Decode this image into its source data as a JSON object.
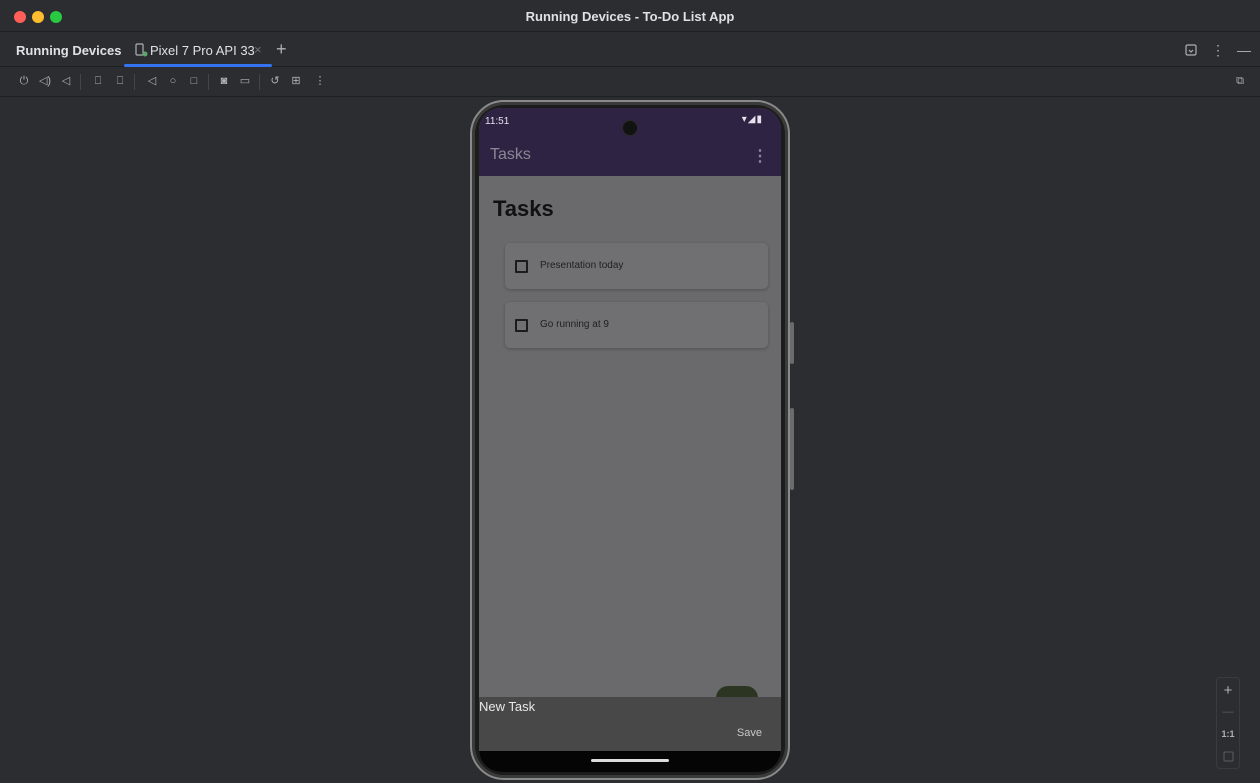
{
  "window": {
    "title": "Running Devices - To-Do List App"
  },
  "tool_window": {
    "title": "Running Devices",
    "tab": {
      "label": "Pixel 7 Pro API 33",
      "close": "×"
    },
    "add_tab": "+"
  },
  "header_actions": {
    "minimize": "—",
    "more": "⋮"
  },
  "toolbar": {
    "icons": [
      "power-icon",
      "volume-up-icon",
      "volume-down-icon",
      "rotate-left-icon",
      "rotate-right-icon",
      "back-icon",
      "home-icon",
      "overview-icon",
      "screenshot-icon",
      "screen-record-icon",
      "snapshot-icon",
      "layout-inspector-icon",
      "more-icon"
    ],
    "right_icon": "device-mirror-settings-icon"
  },
  "device": {
    "status_time": "11:51",
    "status_icons": "▾◢▮",
    "app_bar_title": "Tasks",
    "app_bar_menu": "⋮",
    "page_heading": "Tasks",
    "tasks": [
      {
        "label": "Presentation today",
        "checked": false
      },
      {
        "label": "Go running at 9",
        "checked": false
      }
    ],
    "sheet_title": "New Task",
    "save_label": "Save"
  },
  "zoom": {
    "plus": "+",
    "minus": "—",
    "actual": "1:1"
  },
  "colors": {
    "accent": "#3574f0",
    "app_bar": "#2e2342",
    "screen_scrim": "#6a6a6d"
  }
}
